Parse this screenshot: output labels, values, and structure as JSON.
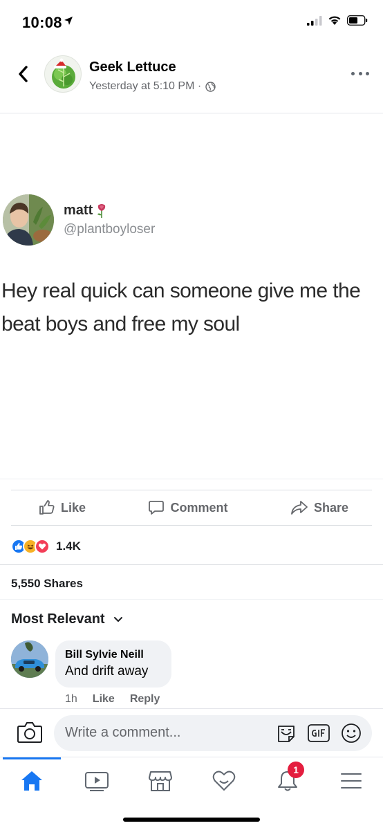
{
  "status_bar": {
    "time": "10:08"
  },
  "post_header": {
    "page_name": "Geek Lettuce",
    "timestamp": "Yesterday at 5:10 PM ·"
  },
  "tweet": {
    "name": "matt",
    "handle": "@plantboyloser",
    "text": "Hey real quick can someone give me the beat boys and free my soul"
  },
  "actions": {
    "like": "Like",
    "comment": "Comment",
    "share": "Share"
  },
  "reactions": {
    "count": "1.4K",
    "types": [
      "like",
      "haha",
      "love"
    ]
  },
  "shares": "5,550 Shares",
  "comments": {
    "sort_label": "Most Relevant",
    "items": [
      {
        "author": "Bill Sylvie Neill",
        "text": "And drift away",
        "time": "1h",
        "like_label": "Like",
        "reply_label": "Reply"
      }
    ]
  },
  "composer": {
    "placeholder": "Write a comment..."
  },
  "tabbar": {
    "notifications_badge": "1",
    "tabs": [
      "home-icon",
      "video-icon",
      "marketplace-icon",
      "dating-icon",
      "bell-icon",
      "menu-icon"
    ]
  },
  "colors": {
    "accent": "#1877f2",
    "badge": "#e41e3f",
    "secondary_text": "#65676b"
  }
}
